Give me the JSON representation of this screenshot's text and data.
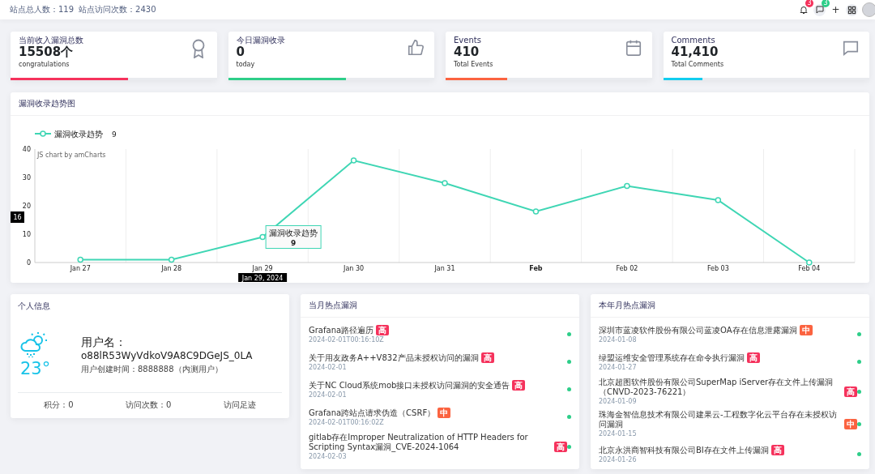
{
  "top_bar": {
    "site_users": "站点总人数：119",
    "site_visits": "站点访问次数：2430",
    "notifications_badge": "3",
    "messages_badge": "3",
    "add_icon": "+"
  },
  "stat_cards": [
    {
      "title": "当前收入漏洞总数",
      "value": "15508个",
      "caption": "congratulations",
      "level": 0.57,
      "color": "#f5325c"
    },
    {
      "title": "今日漏洞收录",
      "value": "0",
      "caption": "today",
      "level": 0.57,
      "color": "#2dce89"
    },
    {
      "title": "Events",
      "value": "410",
      "caption": "Total Events",
      "level": 0.3,
      "color": "#fb6340"
    },
    {
      "title": "Comments",
      "value": "41,410",
      "caption": "Total Comments",
      "level": 0.19,
      "color": "#11cdef"
    }
  ],
  "trend_panel": {
    "title": "漏洞收录趋势图",
    "legend": {
      "value": "9"
    },
    "credit": "JS chart by amCharts",
    "tooltip": {
      "title": "漏洞收录趋势",
      "value": "9"
    },
    "cursor_x_label": "Jan 29, 2024",
    "cursor_y_label": "16",
    "chart_data": {
      "type": "line",
      "categories": [
        "Jan 27",
        "Jan 28",
        "Jan 29",
        "Jan 30",
        "Jan 31",
        "Feb",
        "Feb 02",
        "Feb 03",
        "Feb 04"
      ],
      "series": [
        {
          "name": "漏洞收录趋势",
          "color": "#3fd6b4",
          "marker": true,
          "values": [
            1,
            1,
            9,
            36,
            28,
            18,
            27,
            22,
            0
          ]
        }
      ],
      "ylim": [
        0,
        40
      ],
      "yticks": [
        0,
        10,
        20,
        30,
        40
      ]
    }
  },
  "profile": {
    "title": "个人信息",
    "temperature": "23°",
    "username_label": "用户名：",
    "username": "o88lR53WyVdkoV9A8C9DGeJS_0LA",
    "created": "用户创建时间：8888888（内测用户）",
    "points": "积分：0",
    "visits": "访问次数：0",
    "footprint": "访问足迹"
  },
  "hot_lists": [
    {
      "title": "当月热点漏洞",
      "items": [
        {
          "name": "Grafana路径遍历",
          "badge": "高",
          "kind": "high",
          "date": "2024-02-01T00:16:10Z"
        },
        {
          "name": "关于用友政务A++V832产品未授权访问的漏洞",
          "badge": "高",
          "kind": "high",
          "date": "2024-02-01"
        },
        {
          "name": "关于NC Cloud系统mob接口未授权访问漏洞的安全通告",
          "badge": "高",
          "kind": "high",
          "date": "2024-02-01"
        },
        {
          "name": "Grafana跨站点请求伪造（CSRF）",
          "badge": "中",
          "kind": "medium",
          "date": "2024-02-01T00:16:02Z"
        },
        {
          "name": "gitlab存在Improper Neutralization of HTTP Headers for Scripting Syntax漏洞_CVE-2024-1064",
          "badge": "高",
          "kind": "high",
          "date": "2024-02-03"
        }
      ]
    },
    {
      "title": "本年月热点漏洞",
      "items": [
        {
          "name": "深圳市蓝凌软件股份有限公司蓝凌OA存在信息泄露漏洞",
          "badge": "中",
          "kind": "medium",
          "date": "2024-01-08"
        },
        {
          "name": "绿盟运维安全管理系统存在命令执行漏洞",
          "badge": "高",
          "kind": "high",
          "date": "2024-01-27"
        },
        {
          "name": "北京超图软件股份有限公司SuperMap iServer存在文件上传漏洞（CNVD-2023-76221）",
          "badge": "高",
          "kind": "high",
          "date": "2024-01-09"
        },
        {
          "name": "珠海金智信息技术有限公司建果云-工程数字化云平台存在未授权访问漏洞",
          "badge": "中",
          "kind": "medium",
          "date": "2024-01-15"
        },
        {
          "name": "北京永洪商智科技有限公司BI存在文件上传漏洞",
          "badge": "高",
          "kind": "high",
          "date": "2024-01-26"
        }
      ]
    }
  ]
}
